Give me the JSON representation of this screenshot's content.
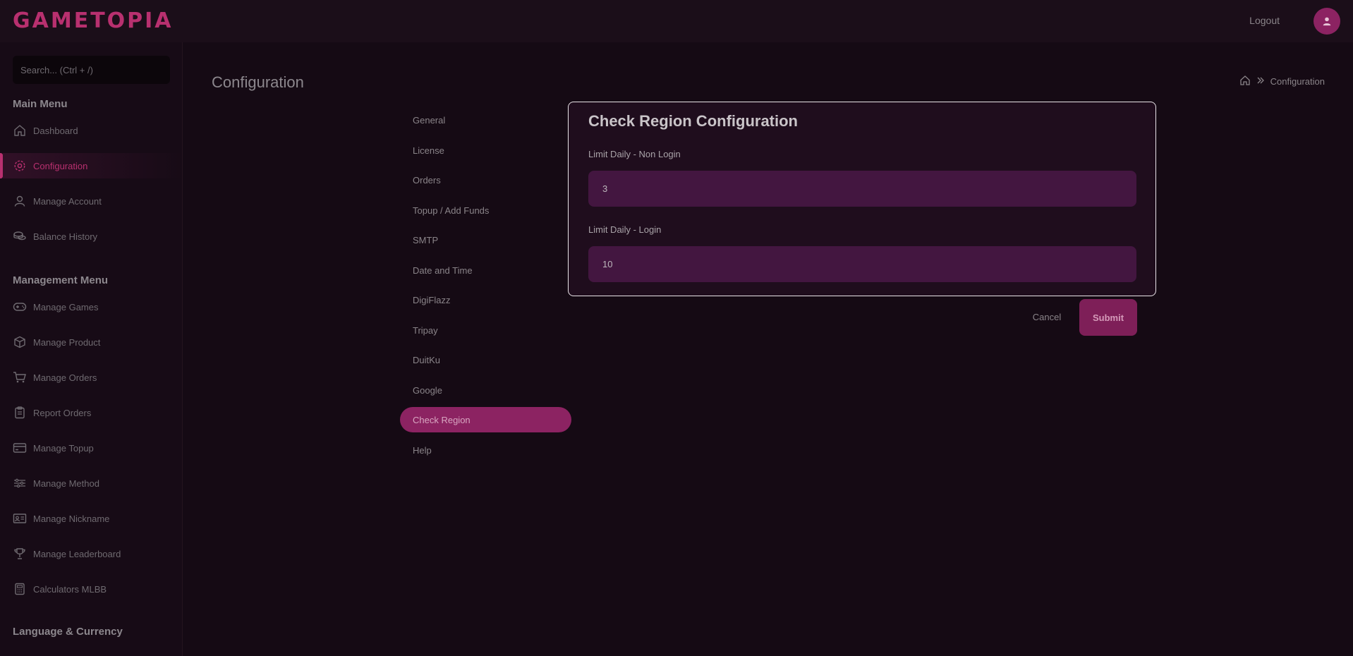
{
  "header": {
    "logo": "GAMETOPIA",
    "logout": "Logout",
    "avatar_icon": "user-icon"
  },
  "sidebar": {
    "search_placeholder": "Search... (Ctrl + /)",
    "main_menu_title": "Main Menu",
    "main_menu": [
      {
        "label": "Dashboard",
        "icon": "home-icon"
      },
      {
        "label": "Configuration",
        "icon": "gear-icon",
        "active": true
      },
      {
        "label": "Manage Account",
        "icon": "user-icon"
      },
      {
        "label": "Balance History",
        "icon": "coins-icon"
      }
    ],
    "management_menu_title": "Management Menu",
    "management_menu": [
      {
        "label": "Manage Games",
        "icon": "gamepad-icon"
      },
      {
        "label": "Manage Product",
        "icon": "box-icon"
      },
      {
        "label": "Manage Orders",
        "icon": "cart-icon"
      },
      {
        "label": "Report Orders",
        "icon": "clipboard-icon"
      },
      {
        "label": "Manage Topup",
        "icon": "card-icon"
      },
      {
        "label": "Manage Method",
        "icon": "sliders-icon"
      },
      {
        "label": "Manage Nickname",
        "icon": "id-card-icon"
      },
      {
        "label": "Manage Leaderboard",
        "icon": "trophy-icon"
      },
      {
        "label": "Calculators MLBB",
        "icon": "calculator-icon"
      }
    ],
    "language_title": "Language & Currency"
  },
  "page": {
    "title": "Configuration",
    "breadcrumb": {
      "home_icon": "home-icon",
      "separator_icon": "double-chevron-right-icon",
      "current": "Configuration"
    }
  },
  "subnav": [
    {
      "label": "General"
    },
    {
      "label": "License"
    },
    {
      "label": "Orders"
    },
    {
      "label": "Topup / Add Funds"
    },
    {
      "label": "SMTP"
    },
    {
      "label": "Date and Time"
    },
    {
      "label": "DigiFlazz"
    },
    {
      "label": "Tripay"
    },
    {
      "label": "DuitKu"
    },
    {
      "label": "Google"
    },
    {
      "label": "Check Region",
      "active": true
    },
    {
      "label": "Help"
    }
  ],
  "form": {
    "title": "Check Region Configuration",
    "fields": [
      {
        "label": "Limit Daily - Non Login",
        "value": "3"
      },
      {
        "label": "Limit Daily - Login",
        "value": "10"
      }
    ],
    "cancel": "Cancel",
    "submit": "Submit"
  }
}
